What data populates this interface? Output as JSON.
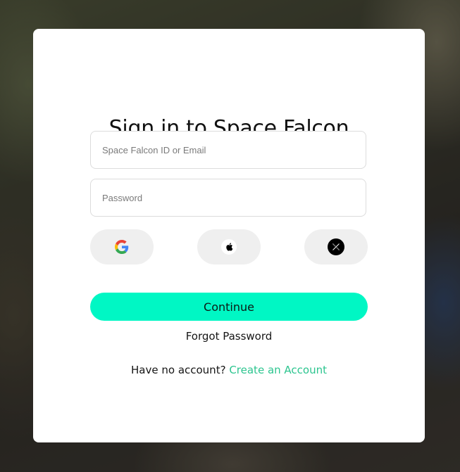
{
  "login": {
    "title": "Sign in to Space Falcon",
    "email_placeholder": "Space Falcon ID or Email",
    "password_placeholder": "Password",
    "continue_label": "Continue",
    "forgot_label": "Forgot Password",
    "no_account_text": "Have no account?",
    "create_account_label": "Create an Account"
  },
  "social": [
    {
      "icon": "google-icon"
    },
    {
      "icon": "apple-icon"
    },
    {
      "icon": "x-icon"
    }
  ],
  "colors": {
    "accent": "#00f7c4",
    "link": "#2cc58f",
    "social_bg": "#efefef"
  }
}
